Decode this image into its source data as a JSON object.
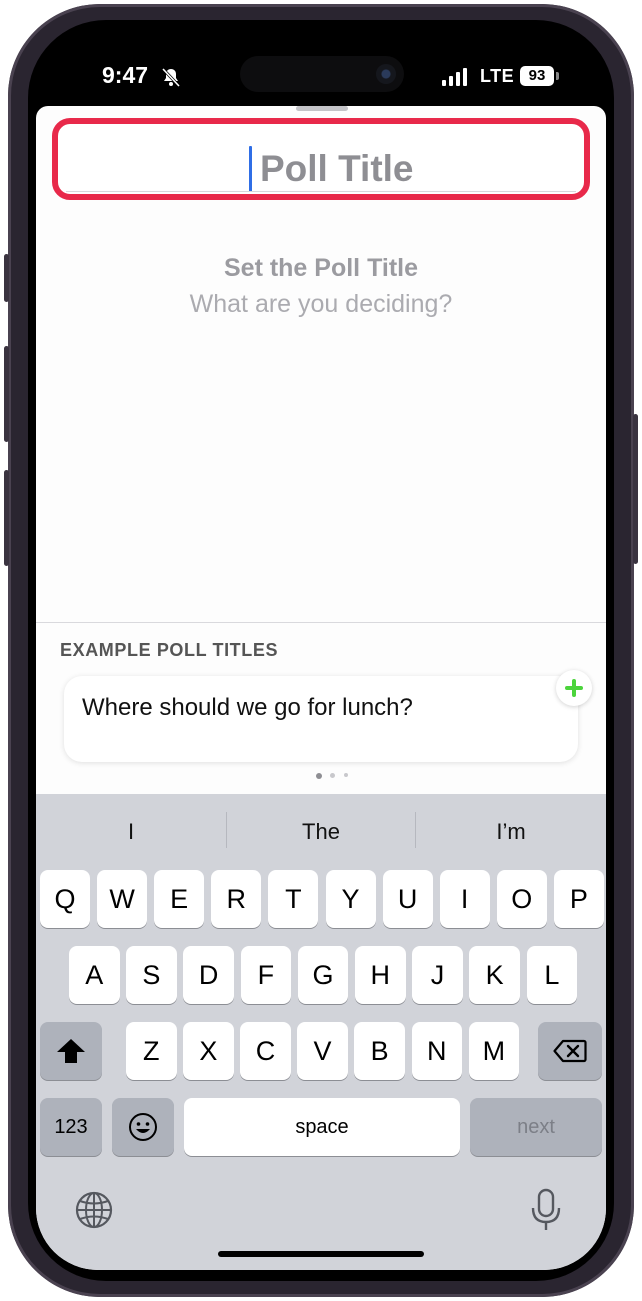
{
  "status_bar": {
    "time": "9:47",
    "network": "LTE",
    "battery": "93",
    "silent_icon": "bell-slash-icon"
  },
  "poll": {
    "title_placeholder": "Poll Title",
    "heading": "Set the Poll Title",
    "subheading": "What are you deciding?"
  },
  "examples": {
    "label": "EXAMPLE POLL TITLES",
    "items": [
      "Where should we go for lunch?"
    ],
    "add_icon": "plus-icon",
    "page_count": 3,
    "active_page": 1
  },
  "keyboard": {
    "suggestions": [
      "I",
      "The",
      "I’m"
    ],
    "rows": [
      [
        "Q",
        "W",
        "E",
        "R",
        "T",
        "Y",
        "U",
        "I",
        "O",
        "P"
      ],
      [
        "A",
        "S",
        "D",
        "F",
        "G",
        "H",
        "J",
        "K",
        "L"
      ],
      [
        "Z",
        "X",
        "C",
        "V",
        "B",
        "N",
        "M"
      ]
    ],
    "numbers_label": "123",
    "space_label": "space",
    "next_label": "next",
    "icons": {
      "shift": "shift-icon",
      "delete": "delete-icon",
      "emoji": "emoji-icon",
      "globe": "globe-icon",
      "mic": "mic-icon"
    }
  },
  "colors": {
    "highlight": "#e8294a",
    "accent_add": "#4cd43c",
    "caret": "#2f6ee6"
  }
}
